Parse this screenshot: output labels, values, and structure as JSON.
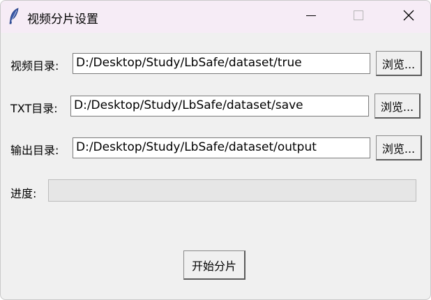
{
  "window": {
    "title": "视频分片设置"
  },
  "titlebar": {
    "icon": "feather-icon",
    "minimize_icon": "minimize-icon",
    "maximize_icon": "maximize-icon",
    "close_icon": "close-icon"
  },
  "rows": {
    "video_dir": {
      "label": "视频目录:",
      "value": "D:/Desktop/Study/LbSafe/dataset/true",
      "browse_label": "浏览..."
    },
    "txt_dir": {
      "label": "TXT目录:",
      "value": "D:/Desktop/Study/LbSafe/dataset/save",
      "browse_label": "浏览..."
    },
    "output_dir": {
      "label": "输出目录:",
      "value": "D:/Desktop/Study/LbSafe/dataset/output",
      "browse_label": "浏览..."
    }
  },
  "progress": {
    "label": "进度:",
    "value_percent": 0,
    "fill_color": "#06b025"
  },
  "actions": {
    "start_label": "开始分片"
  },
  "colors": {
    "titlebar_bg": "#f6ecf6",
    "window_bg": "#f0f0f0"
  }
}
